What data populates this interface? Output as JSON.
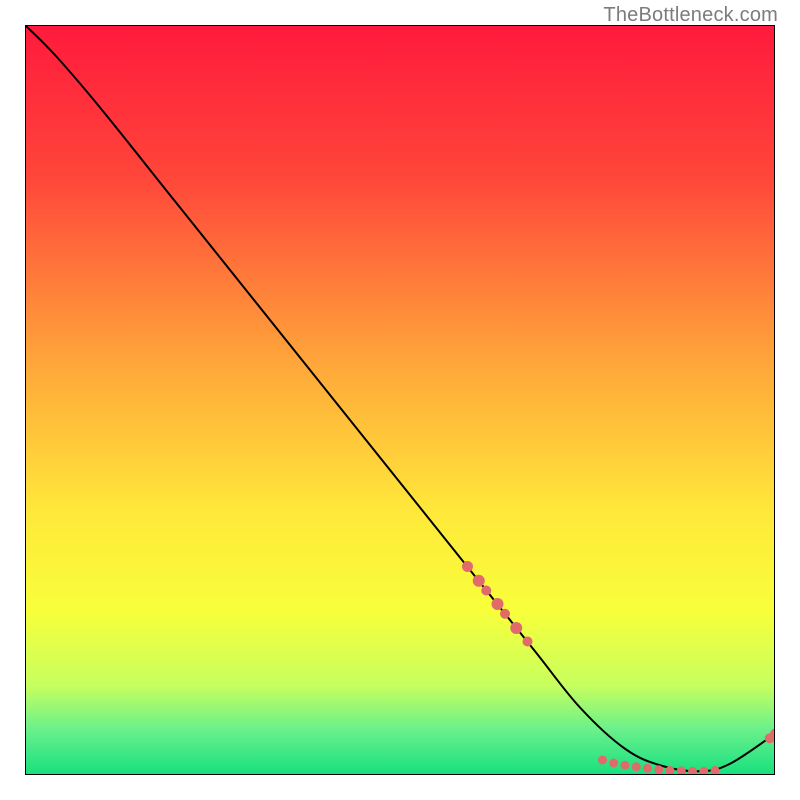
{
  "attribution": "TheBottleneck.com",
  "chart_data": {
    "type": "line",
    "title": "",
    "xlabel": "",
    "ylabel": "",
    "xlim": [
      0,
      100
    ],
    "ylim": [
      0,
      100
    ],
    "gradient_stops": [
      {
        "offset": 0,
        "color": "#ff1a3d"
      },
      {
        "offset": 20,
        "color": "#ff453a"
      },
      {
        "offset": 45,
        "color": "#ffa63a"
      },
      {
        "offset": 65,
        "color": "#ffe83a"
      },
      {
        "offset": 78,
        "color": "#f8ff3a"
      },
      {
        "offset": 88,
        "color": "#c7ff5e"
      },
      {
        "offset": 94,
        "color": "#69f08c"
      },
      {
        "offset": 100,
        "color": "#16e07e"
      }
    ],
    "series": [
      {
        "name": "bottleneck-curve",
        "x": [
          0,
          4,
          10,
          20,
          30,
          40,
          50,
          60,
          68,
          74,
          80,
          85,
          90,
          94,
          100
        ],
        "y": [
          100,
          96,
          89,
          76.5,
          64,
          51.5,
          39,
          26.5,
          16.5,
          9,
          3.5,
          1.2,
          0.5,
          1.5,
          5.5
        ]
      }
    ],
    "markers": {
      "name": "bottleneck-points",
      "color": "#e16a6a",
      "points": [
        {
          "x": 59.0,
          "y": 27.8,
          "r": 5.5
        },
        {
          "x": 60.5,
          "y": 25.9,
          "r": 6.0
        },
        {
          "x": 61.5,
          "y": 24.6,
          "r": 5.0
        },
        {
          "x": 63.0,
          "y": 22.8,
          "r": 6.0
        },
        {
          "x": 64.0,
          "y": 21.5,
          "r": 5.0
        },
        {
          "x": 65.5,
          "y": 19.6,
          "r": 6.0
        },
        {
          "x": 67.0,
          "y": 17.8,
          "r": 5.0
        },
        {
          "x": 77.0,
          "y": 2.0,
          "r": 4.5
        },
        {
          "x": 78.5,
          "y": 1.6,
          "r": 4.5
        },
        {
          "x": 80.0,
          "y": 1.3,
          "r": 4.5
        },
        {
          "x": 81.5,
          "y": 1.1,
          "r": 4.5
        },
        {
          "x": 83.0,
          "y": 0.9,
          "r": 4.5
        },
        {
          "x": 84.5,
          "y": 0.7,
          "r": 4.5
        },
        {
          "x": 86.0,
          "y": 0.6,
          "r": 4.5
        },
        {
          "x": 87.5,
          "y": 0.55,
          "r": 4.5
        },
        {
          "x": 89.0,
          "y": 0.5,
          "r": 4.5
        },
        {
          "x": 90.5,
          "y": 0.5,
          "r": 4.5
        },
        {
          "x": 92.0,
          "y": 0.6,
          "r": 4.5
        },
        {
          "x": 99.3,
          "y": 4.9,
          "r": 5.0
        },
        {
          "x": 100.0,
          "y": 5.5,
          "r": 5.0
        }
      ]
    }
  }
}
